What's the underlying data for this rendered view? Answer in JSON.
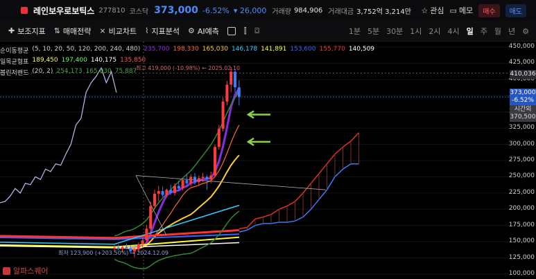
{
  "header": {
    "stock_name": "레인보우로보틱스",
    "stock_code": "277810",
    "market": "코스닥",
    "price": "373,000",
    "change_pct": "-6.52%",
    "change_val": "▾ 26,000",
    "volume_label": "거래량",
    "volume": "984,906",
    "amount_label": "거래대금",
    "amount": "3,752억 3,214만",
    "watch_label": "관심",
    "memo_label": "메모",
    "buy_label": "매수",
    "sell_label": "매도"
  },
  "toolbar": {
    "indicators": "보조지표",
    "strategy": "매매전략",
    "compare": "비교차트",
    "analysis": "지표분석",
    "ai": "AI예측",
    "periods": [
      "1분",
      "5분",
      "30분",
      "1시",
      "2시",
      "4시",
      "일",
      "주",
      "월",
      "년"
    ],
    "active_period": "일"
  },
  "legend": {
    "ma": {
      "label": "순이동평균",
      "params": "(5, 10, 20, 50, 120, 200, 240, 480)",
      "values": [
        "235,700",
        "198,330",
        "165,030",
        "146,178",
        "141,891",
        "153,600",
        "155,770",
        "140,509"
      ],
      "colors": [
        "#8a2be2",
        "#ff6633",
        "#ffcc33",
        "#33ccff",
        "#ffff33",
        "#3366ff",
        "#ff3333",
        "#ffffff"
      ]
    },
    "ichimoku": {
      "label": "일목균형표",
      "values": [
        "189,450",
        "197,400",
        "140,175",
        "135,850"
      ],
      "colors": [
        "#ffff66",
        "#66ff66",
        "#ffffff",
        "#ff5555"
      ]
    },
    "bollinger": {
      "label": "볼린저밴드",
      "params": "(20, 2)",
      "values": [
        "254,173",
        "165,030",
        "75,887"
      ],
      "colors": [
        "#44aa44",
        "#44aa44",
        "#44aa44"
      ]
    }
  },
  "annotations": {
    "max": "최고 419,000 (-10.98%) ← 2025.02.10",
    "min": "최저 123,900 (+203.50%) → 2024.12.09"
  },
  "price_tags": {
    "crosshair": "410,036",
    "current_price": "373,000",
    "current_pct": "-6.52%",
    "open_label": "시간외",
    "open_price": "370,500"
  },
  "watermark": "알파스퀘어",
  "chart_data": {
    "type": "candlestick",
    "y_axis_labels": [
      "450,000",
      "425,000",
      "400,000",
      "375,000",
      "350,000",
      "325,000",
      "300,000",
      "275,000",
      "250,000",
      "225,000",
      "200,000",
      "175,000",
      "150,000",
      "125,000",
      "100,000"
    ],
    "ylim": [
      100000,
      450000
    ],
    "candles": [
      {
        "o": 140000,
        "h": 145000,
        "l": 135000,
        "c": 141000
      },
      {
        "o": 141000,
        "h": 146000,
        "l": 137000,
        "c": 139000
      },
      {
        "o": 139000,
        "h": 144000,
        "l": 134000,
        "c": 142000
      },
      {
        "o": 142000,
        "h": 147000,
        "l": 138000,
        "c": 140000
      },
      {
        "o": 140000,
        "h": 145000,
        "l": 132000,
        "c": 135000
      },
      {
        "o": 135000,
        "h": 141000,
        "l": 126000,
        "c": 138000
      },
      {
        "o": 138000,
        "h": 149000,
        "l": 134000,
        "c": 146000
      },
      {
        "o": 146000,
        "h": 158000,
        "l": 141000,
        "c": 152000
      },
      {
        "o": 152000,
        "h": 176000,
        "l": 148000,
        "c": 170000
      },
      {
        "o": 170000,
        "h": 212000,
        "l": 165000,
        "c": 205000
      },
      {
        "o": 205000,
        "h": 230000,
        "l": 200000,
        "c": 224000
      },
      {
        "o": 224000,
        "h": 236000,
        "l": 212000,
        "c": 228000
      },
      {
        "o": 228000,
        "h": 235000,
        "l": 219000,
        "c": 222000
      },
      {
        "o": 222000,
        "h": 232000,
        "l": 218000,
        "c": 230000
      },
      {
        "o": 230000,
        "h": 238000,
        "l": 222000,
        "c": 225000
      },
      {
        "o": 225000,
        "h": 240000,
        "l": 221000,
        "c": 236000
      },
      {
        "o": 236000,
        "h": 244000,
        "l": 228000,
        "c": 232000
      },
      {
        "o": 232000,
        "h": 248000,
        "l": 229000,
        "c": 245000
      },
      {
        "o": 245000,
        "h": 255000,
        "l": 235000,
        "c": 240000
      },
      {
        "o": 240000,
        "h": 254000,
        "l": 236000,
        "c": 250000
      },
      {
        "o": 250000,
        "h": 256000,
        "l": 238000,
        "c": 242000
      },
      {
        "o": 242000,
        "h": 252000,
        "l": 236000,
        "c": 248000
      },
      {
        "o": 248000,
        "h": 256000,
        "l": 242000,
        "c": 250000
      },
      {
        "o": 250000,
        "h": 253000,
        "l": 230000,
        "c": 246000
      },
      {
        "o": 246000,
        "h": 258000,
        "l": 240000,
        "c": 252000
      },
      {
        "o": 252000,
        "h": 300000,
        "l": 250000,
        "c": 296000
      },
      {
        "o": 296000,
        "h": 330000,
        "l": 292000,
        "c": 324000
      },
      {
        "o": 324000,
        "h": 372000,
        "l": 320000,
        "c": 366000
      },
      {
        "o": 366000,
        "h": 398000,
        "l": 360000,
        "c": 392000
      },
      {
        "o": 392000,
        "h": 419000,
        "l": 380000,
        "c": 412000
      },
      {
        "o": 412000,
        "h": 416000,
        "l": 380000,
        "c": 388000
      },
      {
        "o": 388000,
        "h": 399000,
        "l": 360000,
        "c": 373000
      }
    ]
  }
}
